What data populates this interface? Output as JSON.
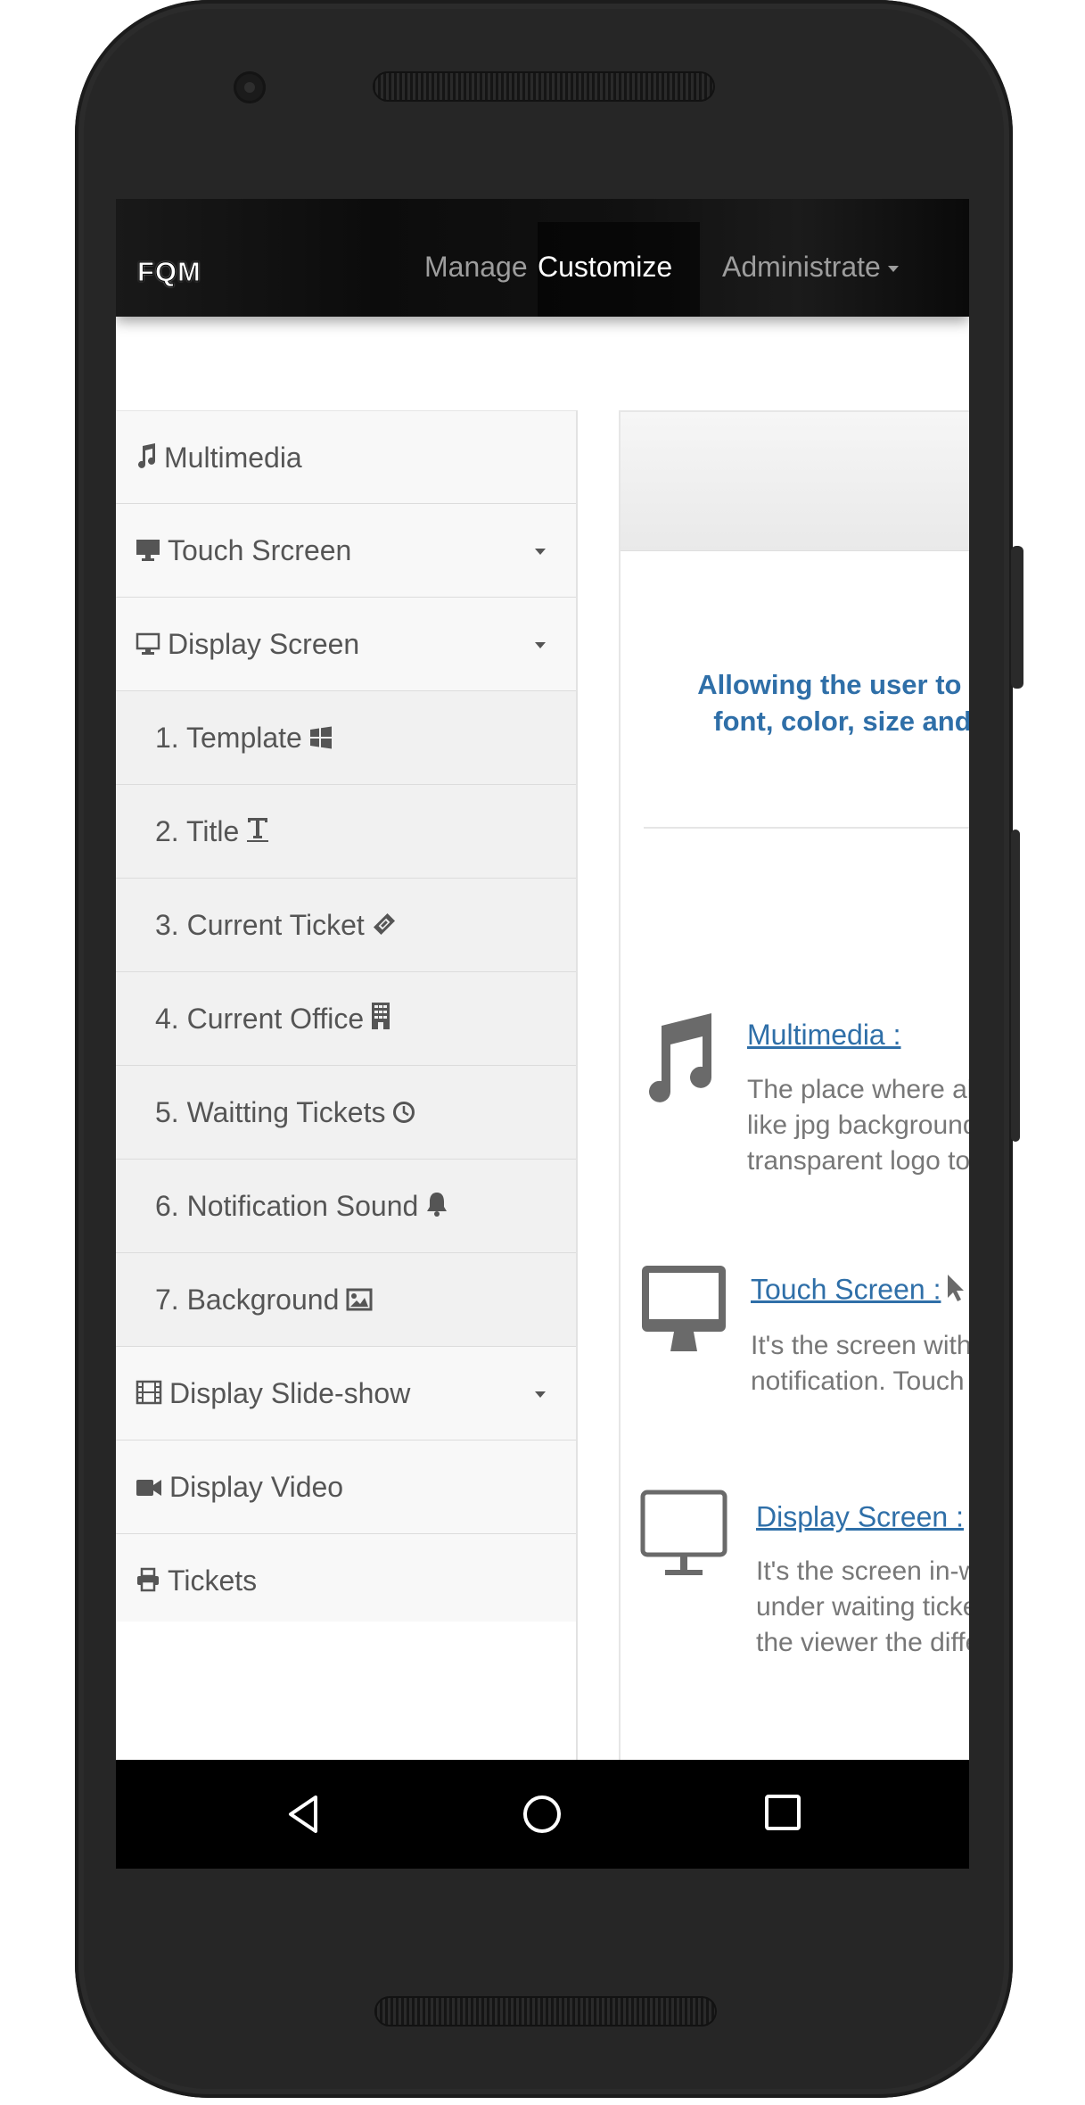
{
  "navbar": {
    "brand": "FQM",
    "links": [
      {
        "label": "Manage",
        "active": false
      },
      {
        "label": "Customize",
        "active": true
      },
      {
        "label": "Administrate",
        "active": false,
        "dropdown": true
      }
    ]
  },
  "sidebar": {
    "items": [
      {
        "label": "Multimedia",
        "icon": "music-icon",
        "dropdown": false
      },
      {
        "label": "Touch Srcreen",
        "icon": "desktop-icon",
        "dropdown": true
      },
      {
        "label": "Display Screen",
        "icon": "monitor-icon",
        "dropdown": true
      },
      {
        "label": "1. Template",
        "icon": "windows-icon",
        "sub": true
      },
      {
        "label": "2. Title",
        "icon": "text-icon",
        "sub": true
      },
      {
        "label": "3. Current Ticket",
        "icon": "ticket-icon",
        "sub": true
      },
      {
        "label": "4. Current Office",
        "icon": "building-icon",
        "sub": true
      },
      {
        "label": "5. Waitting Tickets",
        "icon": "clock-icon",
        "sub": true
      },
      {
        "label": "6. Notification Sound",
        "icon": "bell-icon",
        "sub": true
      },
      {
        "label": "7. Background",
        "icon": "image-icon",
        "sub": true
      },
      {
        "label": "Display Slide-show",
        "icon": "film-icon",
        "dropdown": true
      },
      {
        "label": "Display Video",
        "icon": "video-icon",
        "dropdown": false
      },
      {
        "label": "Tickets",
        "icon": "print-icon",
        "dropdown": false
      }
    ]
  },
  "main": {
    "intro_line1": "Allowing the user to custo",
    "intro_line2": "font, color, size and bac",
    "features": [
      {
        "title": "Multimedia :",
        "icon": "music-large-icon",
        "desc": [
          "The place where all",
          "like jpg background",
          "transparent logo to"
        ]
      },
      {
        "title": "Touch Screen :",
        "icon": "desktop-large-icon",
        "desc": [
          "It's the screen with-",
          "notification. Touch s"
        ]
      },
      {
        "title": "Display Screen :",
        "icon": "monitor-large-icon",
        "desc": [
          "It's the screen in-w",
          "under waiting ticke",
          "the viewer the diffe"
        ]
      }
    ]
  },
  "colors": {
    "accent": "#2f6fa8",
    "navbar": "#111111",
    "menu_bg": "#f8f8f8",
    "submenu_bg": "#f1f1f1"
  }
}
